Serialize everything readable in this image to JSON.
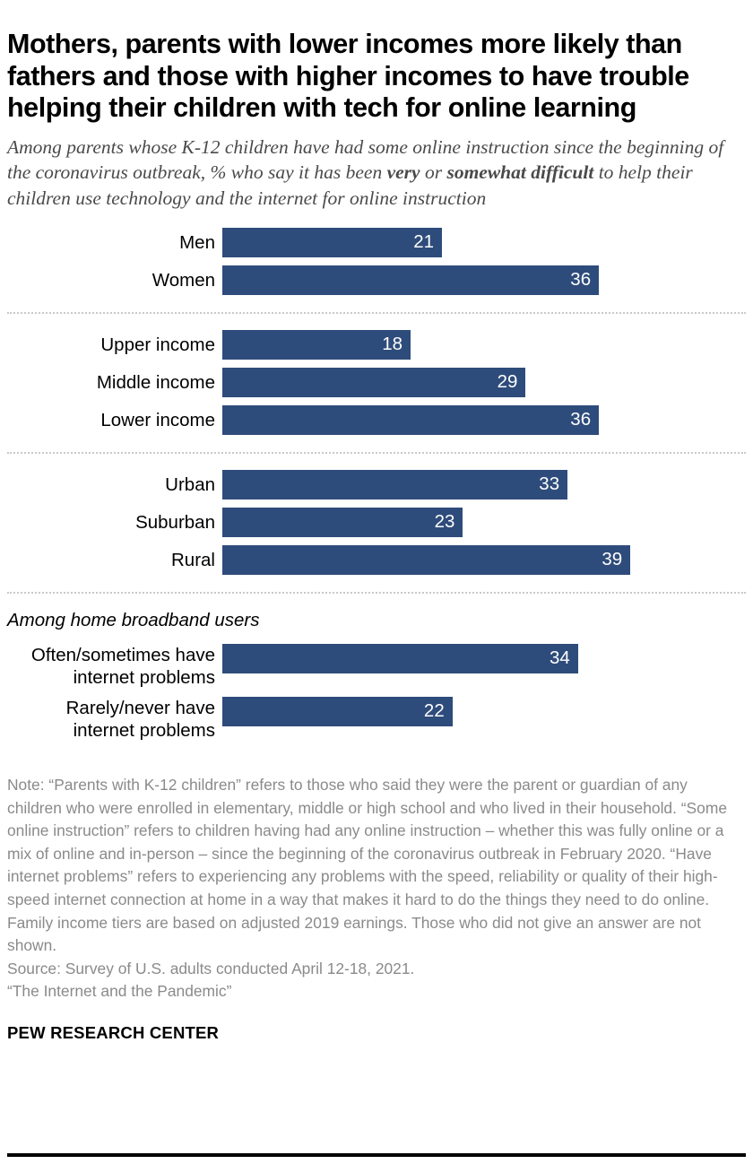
{
  "title": "Mothers, parents with lower incomes more likely than fathers and those with higher incomes to have trouble helping their children with tech for online learning",
  "subtitle": {
    "part1": "Among parents whose K-12 children have had some online instruction since the beginning of the coronavirus outbreak, % who say it has been ",
    "bold1": "very",
    "part2": " or ",
    "bold2": "somewhat difficult",
    "part3": " to help their children use technology and the internet for online instruction"
  },
  "section_label": "Among home broadband users",
  "footnotes": {
    "note": "Note: “Parents with K-12 children” refers to those who said they were the parent or guardian of any children who were enrolled in elementary, middle or high school and who lived in their household. “Some online instruction” refers to children having had any online instruction – whether this was fully online or a mix of online and in-person – since the beginning of the coronavirus outbreak in February 2020. “Have internet problems” refers to experiencing any problems with the speed, reliability or quality of their high-speed internet connection at home in a way that makes it hard to do the things they need to do online. Family income tiers are based on adjusted 2019 earnings. Those who did not give an answer are not shown.",
    "source": "Source: Survey of U.S. adults conducted April 12-18, 2021.",
    "report": "“The Internet and the Pandemic”"
  },
  "brand": "PEW RESEARCH CENTER",
  "colors": {
    "bar": "#2e4c7b",
    "value_text": "#ffffff",
    "subtitle_text": "#4a4a4a",
    "note_text": "#8a8a8a",
    "divider": "#c9c9c9",
    "rule": "#000000"
  },
  "chart_data": {
    "type": "bar",
    "orientation": "horizontal",
    "title": "Mothers, parents with lower incomes more likely than fathers and those with higher incomes to have trouble helping their children with tech for online learning",
    "subtitle": "Among parents whose K-12 children have had some online instruction since the beginning of the coronavirus outbreak, % who say it has been very or somewhat difficult to help their children use technology and the internet for online instruction",
    "xlabel": "",
    "ylabel": "",
    "xlim": [
      0,
      50
    ],
    "grid": false,
    "legend": false,
    "value_unit": "%",
    "groups": [
      {
        "name": "gender",
        "categories": [
          "Men",
          "Women"
        ],
        "values": [
          21,
          36
        ]
      },
      {
        "name": "income",
        "categories": [
          "Upper income",
          "Middle income",
          "Lower income"
        ],
        "values": [
          18,
          29,
          36
        ]
      },
      {
        "name": "community",
        "categories": [
          "Urban",
          "Suburban",
          "Rural"
        ],
        "values": [
          33,
          23,
          39
        ]
      },
      {
        "name": "broadband",
        "group_label": "Among home broadband users",
        "categories": [
          "Often/sometimes have\ninternet problems",
          "Rarely/never have\ninternet problems"
        ],
        "values": [
          34,
          22
        ]
      }
    ],
    "categories": [
      "Men",
      "Women",
      "Upper income",
      "Middle income",
      "Lower income",
      "Urban",
      "Suburban",
      "Rural",
      "Often/sometimes have internet problems",
      "Rarely/never have internet problems"
    ],
    "values": [
      21,
      36,
      18,
      29,
      36,
      33,
      23,
      39,
      34,
      22
    ]
  }
}
